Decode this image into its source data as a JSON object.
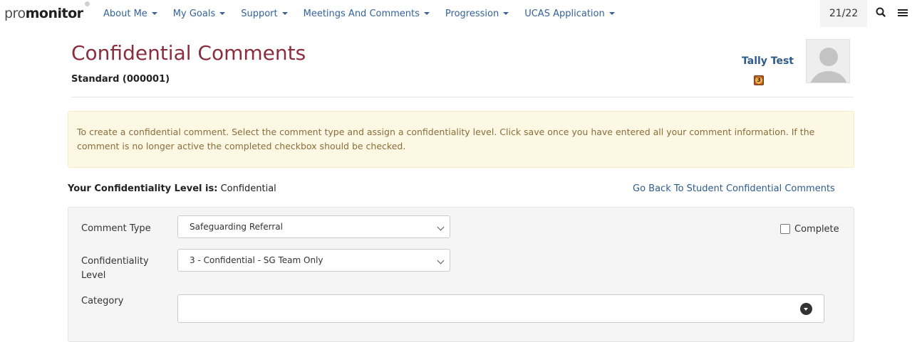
{
  "app": {
    "logo_pro": "pro",
    "logo_mon": "monitor"
  },
  "nav": {
    "items": [
      {
        "label": "About Me"
      },
      {
        "label": "My Goals"
      },
      {
        "label": "Support"
      },
      {
        "label": "Meetings And Comments"
      },
      {
        "label": "Progression"
      },
      {
        "label": "UCAS Application"
      }
    ],
    "year": "21/22",
    "icons": [
      "search-icon",
      "menu-icon"
    ]
  },
  "header": {
    "title": "Confidential Comments",
    "subtitle": "Standard (000001)",
    "user_name": "Tally Test",
    "user_badge": "3"
  },
  "info": {
    "text": "To create a confidential comment. Select the comment type and assign a confidentiality level. Click save once you have entered all your comment information. If the comment is no longer active the completed checkbox should be checked."
  },
  "confidentiality": {
    "label": "Your Confidentiality Level is:",
    "value": "Confidential",
    "back_link": "Go Back To Student Confidential Comments"
  },
  "form": {
    "comment_type_label": "Comment Type",
    "comment_type_value": "Safeguarding Referral",
    "confidentiality_label_1": "Confidentiality",
    "confidentiality_label_2": "Level",
    "confidentiality_value": "3 - Confidential - SG Team Only",
    "category_label": "Category",
    "category_value": "",
    "complete_label": "Complete",
    "complete_checked": false
  },
  "colors": {
    "title": "#8b2d3f",
    "link": "#2e5b8c",
    "info_bg": "#fcf8e3",
    "info_text": "#8a6d3b",
    "panel_bg": "#f5f5f5"
  }
}
